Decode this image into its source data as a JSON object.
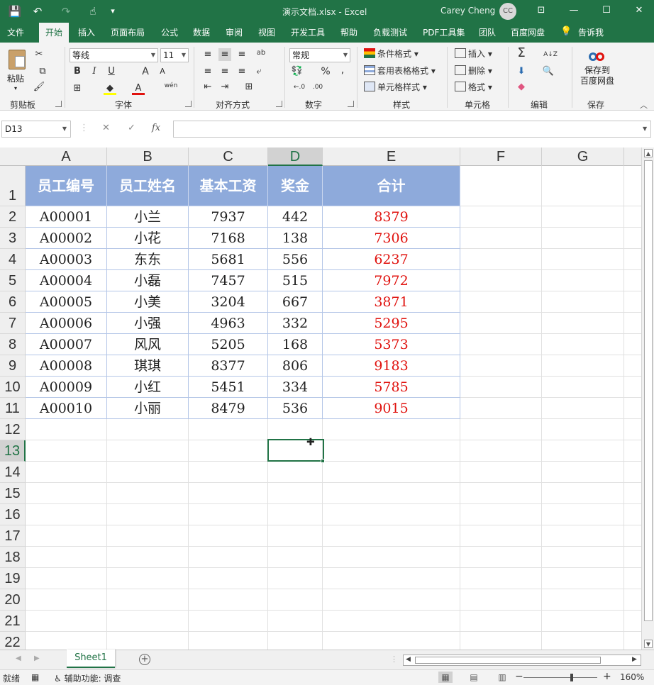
{
  "window": {
    "title": "演示文档.xlsx  -  Excel",
    "user": "Carey Cheng",
    "avatar": "CC",
    "minimize": "—",
    "restore": "☐",
    "close": "✕",
    "ribbon_display": "⊡"
  },
  "quick_access": {
    "save": "💾",
    "undo": "↶",
    "redo": "↷",
    "touch": "☝",
    "customize": "▾"
  },
  "tabs": [
    "文件",
    "开始",
    "插入",
    "页面布局",
    "公式",
    "数据",
    "审阅",
    "视图",
    "开发工具",
    "帮助",
    "负载测试",
    "PDF工具集",
    "团队",
    "百度网盘",
    "告诉我"
  ],
  "active_tab": "开始",
  "ribbon": {
    "clipboard": {
      "label": "剪贴板",
      "paste": "粘贴",
      "cut": "✂",
      "copy": "⧉",
      "painter": "🖌"
    },
    "font": {
      "label": "字体",
      "name": "等线",
      "size": "11",
      "bold": "B",
      "italic": "I",
      "underline": "U",
      "grow": "A",
      "shrink": "A",
      "font_color": "A",
      "wen": "wén"
    },
    "alignment": {
      "label": "对齐方式",
      "orientation": "ab",
      "wrap": "⤶",
      "merge": "⊞"
    },
    "number": {
      "label": "数字",
      "format": "常规",
      "percent": "%",
      "comma": ",",
      "inc": "←.0",
      "dec": ".00"
    },
    "styles": {
      "label": "样式",
      "conditional": "条件格式",
      "table": "套用表格格式",
      "cell_styles": "单元格样式"
    },
    "cells": {
      "label": "单元格",
      "insert": "插入",
      "delete": "删除",
      "format": "格式"
    },
    "editing": {
      "label": "编辑",
      "sum": "Σ",
      "sort": "A↓Z",
      "find": "🔍",
      "fill": "⬇",
      "clear": "◆"
    },
    "save": {
      "label": "保存",
      "button_line1": "保存到",
      "button_line2": "百度网盘"
    }
  },
  "formula_bar": {
    "name_box": "D13",
    "cancel": "✕",
    "enter": "✓",
    "fx": "fx",
    "value": ""
  },
  "columns": [
    "A",
    "B",
    "C",
    "D",
    "E",
    "F",
    "G"
  ],
  "rows": [
    "1",
    "2",
    "3",
    "4",
    "5",
    "6",
    "7",
    "8",
    "9",
    "10",
    "11",
    "12",
    "13",
    "14",
    "15",
    "16",
    "17",
    "18",
    "19",
    "20",
    "21",
    "22"
  ],
  "selected_cell": "D13",
  "table": {
    "headers": [
      "员工编号",
      "员工姓名",
      "基本工资",
      "奖金",
      "合计"
    ],
    "rows": [
      [
        "A00001",
        "小兰",
        "7937",
        "442",
        "8379"
      ],
      [
        "A00002",
        "小花",
        "7168",
        "138",
        "7306"
      ],
      [
        "A00003",
        "东东",
        "5681",
        "556",
        "6237"
      ],
      [
        "A00004",
        "小磊",
        "7457",
        "515",
        "7972"
      ],
      [
        "A00005",
        "小美",
        "3204",
        "667",
        "3871"
      ],
      [
        "A00006",
        "小强",
        "4963",
        "332",
        "5295"
      ],
      [
        "A00007",
        "风风",
        "5205",
        "168",
        "5373"
      ],
      [
        "A00008",
        "琪琪",
        "8377",
        "806",
        "9183"
      ],
      [
        "A00009",
        "小红",
        "5451",
        "334",
        "5785"
      ],
      [
        "A00010",
        "小丽",
        "8479",
        "536",
        "9015"
      ]
    ]
  },
  "colors": {
    "brand": "#217346",
    "header_fill": "#8eaadb",
    "total_text": "#e0120e"
  },
  "sheets": [
    "Sheet1"
  ],
  "status": {
    "ready": "就绪",
    "accessibility": "辅助功能: 调查",
    "zoom": "160%",
    "zoom_minus": "−",
    "zoom_plus": "+"
  }
}
